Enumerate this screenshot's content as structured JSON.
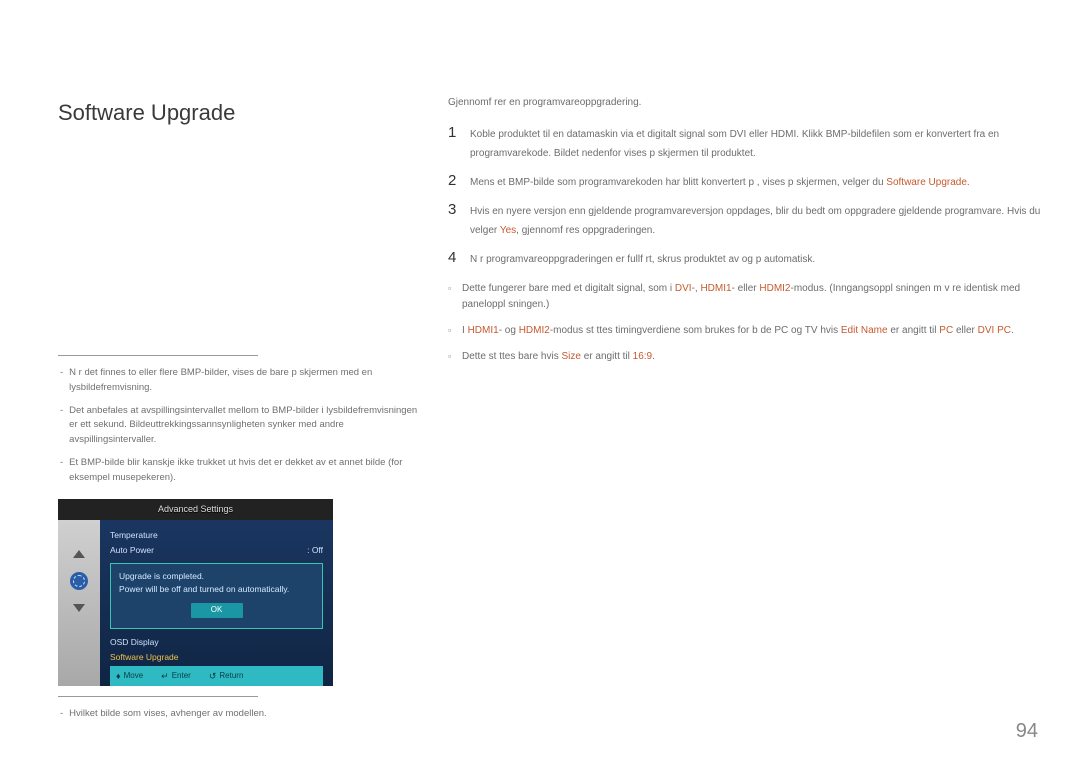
{
  "title": "Software Upgrade",
  "left_notes": {
    "n1": "N r det finnes to eller flere BMP-bilder, vises de bare p  skjermen med en lysbildefremvisning.",
    "n2": "Det anbefales at avspillingsintervallet mellom to BMP-bilder i lysbildefremvisningen er ett sekund. Bildeuttrekkingssannsynligheten synker med andre avspillingsintervaller.",
    "n3": "Et BMP-bilde blir kanskje ikke trukket ut hvis det er dekket av et annet bilde (for eksempel musepekeren).",
    "n4": "Hvilket bilde som vises, avhenger av modellen."
  },
  "right": {
    "intro": "Gjennomf rer en programvareoppgradering.",
    "step1": "Koble produktet til en datamaskin via et digitalt signal som DVI eller HDMI. Klikk BMP-bildefilen som er konvertert fra en programvarekode. Bildet nedenfor vises p  skjermen til produktet.",
    "step2a": "Mens et BMP-bilde som programvarekoden har blitt konvertert p , vises p  skjermen, velger du ",
    "step2b": "Software Upgrade",
    "step2c": ".",
    "step3a": "Hvis en nyere versjon enn gjeldende programvareversjon oppdages, blir du bedt om   oppgradere gjeldende programvare. Hvis du velger ",
    "step3b": "Yes",
    "step3c": ", gjennomf res oppgraderingen.",
    "step4": "N r programvareoppgraderingen er fullf rt, skrus produktet av og p  automatisk.",
    "b1a": "Dette fungerer bare med et digitalt signal, som i ",
    "b1b": "DVI",
    "b1c": "-, ",
    "b1d": "HDMI1",
    "b1e": "- eller ",
    "b1f": "HDMI2",
    "b1g": "-modus. (Inngangsoppl sningen m  v re identisk med paneloppl sningen.)",
    "b2a": "I ",
    "b2b": "HDMI1",
    "b2c": "- og ",
    "b2d": "HDMI2",
    "b2e": "-modus st ttes timingverdiene som brukes for b de PC og TV hvis ",
    "b2f": "Edit Name",
    "b2g": " er angitt til ",
    "b2h": "PC",
    "b2i": " eller ",
    "b2j": "DVI PC",
    "b2k": ".",
    "b3a": "Dette st ttes bare hvis ",
    "b3b": "Size",
    "b3c": " er angitt til ",
    "b3d": "16:9",
    "b3e": "."
  },
  "osd": {
    "header": "Advanced Settings",
    "temperature": "Temperature",
    "autopower_label": "Auto Power",
    "autopower_value": ": Off",
    "popup_line1": "Upgrade is completed.",
    "popup_line2": "Power will be off and turned on automatically.",
    "ok": "OK",
    "osddisplay": "OSD Display",
    "softwareupgrade": "Software Upgrade",
    "foot_move": "Move",
    "foot_enter": "Enter",
    "foot_return": "Return"
  },
  "page_number": "94"
}
